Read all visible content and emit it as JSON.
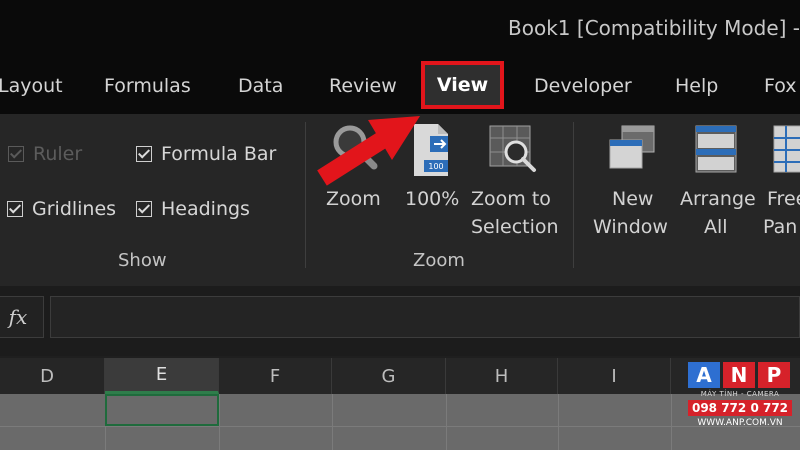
{
  "window": {
    "title": "Book1  [Compatibility Mode]  -"
  },
  "tabs": [
    {
      "label": "Layout"
    },
    {
      "label": "Formulas"
    },
    {
      "label": "Data"
    },
    {
      "label": "Review"
    },
    {
      "label": "View",
      "active": true
    },
    {
      "label": "Developer"
    },
    {
      "label": "Help"
    },
    {
      "label": "Fox"
    }
  ],
  "ribbon": {
    "show_group": {
      "label": "Show",
      "ruler": {
        "label": "Ruler",
        "checked": true,
        "enabled": false
      },
      "formula_bar": {
        "label": "Formula Bar",
        "checked": true
      },
      "gridlines": {
        "label": "Gridlines",
        "checked": true
      },
      "headings": {
        "label": "Headings",
        "checked": true
      }
    },
    "zoom_group": {
      "label": "Zoom",
      "zoom": {
        "label": "Zoom"
      },
      "zoom_100": {
        "label": "100%"
      },
      "zoom_selection": {
        "line1": "Zoom to",
        "line2": "Selection"
      }
    },
    "window_group": {
      "new_window": {
        "line1": "New",
        "line2": "Window"
      },
      "arrange_all": {
        "line1": "Arrange",
        "line2": "All"
      },
      "freeze_panes": {
        "line1": "Free",
        "line2": "Pan"
      }
    }
  },
  "formula_bar": {
    "fx_label": "fx",
    "value": ""
  },
  "columns": [
    "D",
    "E",
    "F",
    "G",
    "H",
    "I"
  ],
  "selected_column": "E",
  "annotation": {
    "arrow_color": "#e2151b"
  },
  "watermark": {
    "letters": [
      "A",
      "N",
      "P"
    ],
    "letter_colors": [
      "#2e6fd1",
      "#d6222a",
      "#d6222a"
    ],
    "tagline": "MÁY TÍNH - CAMERA",
    "phone": "098 772 0 772",
    "url": "WWW.ANP.COM.VN"
  }
}
